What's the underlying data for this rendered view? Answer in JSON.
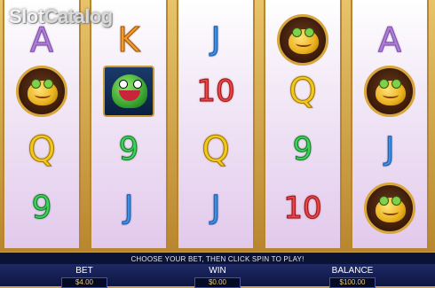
{
  "watermark": {
    "part1": "Slot",
    "part2": "Catalog"
  },
  "reels": [
    [
      "A",
      "frog",
      "Q",
      "9"
    ],
    [
      "K",
      "gecko",
      "9",
      "J"
    ],
    [
      "J",
      "10",
      "Q",
      "J"
    ],
    [
      "frog",
      "Q",
      "9",
      "10"
    ],
    [
      "A",
      "frog",
      "J",
      "frog"
    ]
  ],
  "message": "CHOOSE YOUR BET, THEN CLICK SPIN TO PLAY!",
  "info": {
    "bet_label": "BET",
    "bet_value": "$4.00",
    "win_label": "WIN",
    "win_value": "$0.00",
    "balance_label": "BALANCE",
    "balance_value": "$100.00"
  },
  "colors": {
    "frame": "#c9a24a",
    "bar_dark": "#0b1334",
    "bar_mid": "#1f2a66"
  },
  "icons": {
    "frog": "golden-frog-icon",
    "gecko": "green-gecko-icon"
  }
}
